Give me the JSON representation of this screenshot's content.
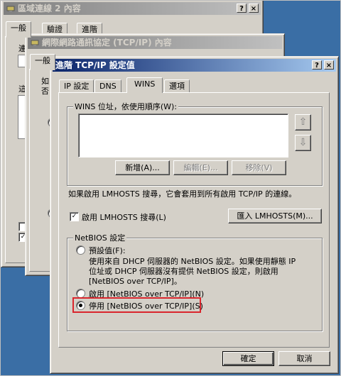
{
  "window1": {
    "title": "區域連線 2 內容",
    "tabs": [
      "一般",
      "驗證",
      "進階"
    ],
    "frag_connect": "連",
    "frag_this": "這",
    "buttons": [
      "?",
      "×"
    ]
  },
  "window2": {
    "title": "網際網路通訊協定 (TCP/IP) 內容",
    "tab": "一般",
    "frag_1": "如",
    "frag_2": "否",
    "buttons": [
      "?",
      "×"
    ]
  },
  "dialog": {
    "title": "進階 TCP/IP 設定值",
    "help_button": "?",
    "close_button": "×",
    "tabs": [
      "IP 設定",
      "DNS",
      "WINS",
      "選項"
    ],
    "wins_group_label": "WINS 位址，依使用順序(W):",
    "up_arrow": "⇧",
    "down_arrow": "⇩",
    "add_button": "新增(A)...",
    "edit_button": "編輯(E)...",
    "remove_button": "移除(V)",
    "lmhosts_note": "如果啟用 LMHOSTS 搜尋，它會套用到所有啟用 TCP/IP 的連線。",
    "lmhosts_check_label": "啟用 LMHOSTS 搜尋(L)",
    "lmhosts_checked": true,
    "import_button": "匯入 LMHOSTS(M)...",
    "netbios_group_label": "NetBIOS 設定",
    "radio_default_label": "預設值(F):",
    "radio_default_desc": [
      "使用來自 DHCP 伺服器的 NetBIOS 設定。如果使用靜態 IP",
      "位址或 DHCP 伺服器沒有提供 NetBIOS 設定，則啟用",
      "[NetBIOS over TCP/IP]。"
    ],
    "radio_enable_label": "啟用 [NetBIOS over TCP/IP](N)",
    "radio_disable_label": "停用 [NetBIOS over TCP/IP](S)",
    "selected_radio": "disable",
    "ok_button": "確定",
    "cancel_button": "取消"
  },
  "colors": {
    "highlight_box": "#d9262d",
    "active_title": "#0a246a"
  }
}
